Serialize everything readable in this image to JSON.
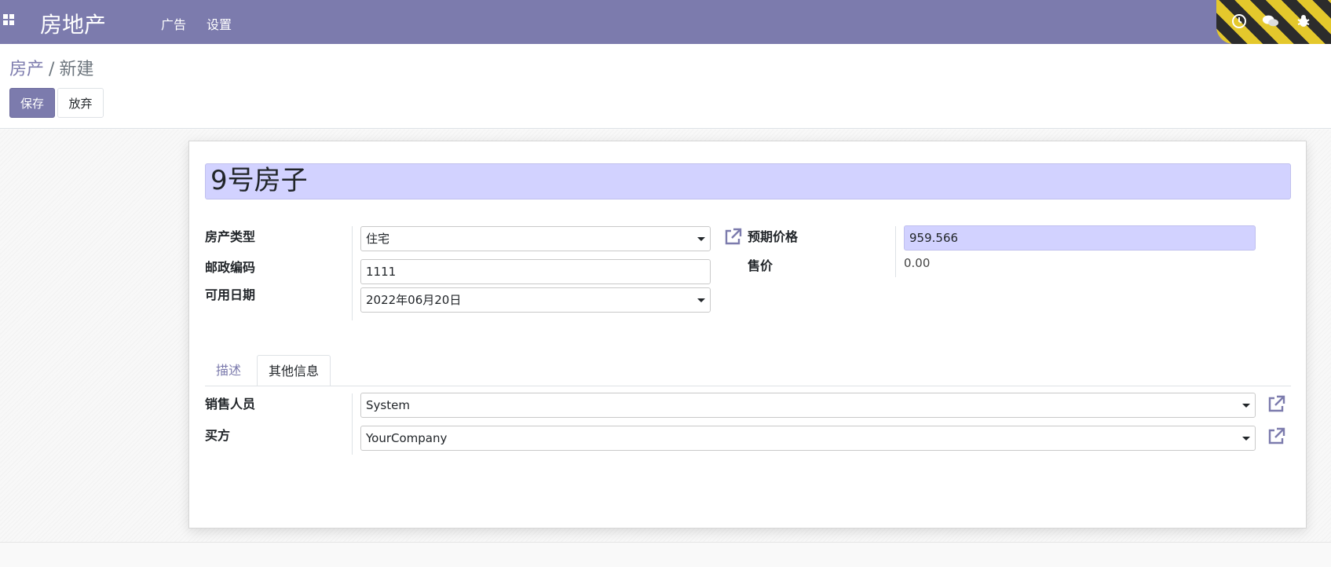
{
  "navbar": {
    "brand": "房地产",
    "menu": [
      "广告",
      "设置"
    ]
  },
  "breadcrumb": {
    "parent": "房产",
    "separator": "/",
    "current": "新建"
  },
  "buttons": {
    "save": "保存",
    "discard": "放弃"
  },
  "form": {
    "name": "9号房子",
    "property_type_label": "房产类型",
    "property_type": "住宅",
    "postcode_label": "邮政编码",
    "postcode": "1111",
    "date_available_label": "可用日期",
    "date_available": "2022年06月20日",
    "expected_price_label": "预期价格",
    "expected_price": "959.566",
    "selling_price_label": "售价",
    "selling_price": "0.00"
  },
  "tabs": [
    "描述",
    "其他信息"
  ],
  "other_info": {
    "salesperson_label": "销售人员",
    "salesperson": "System",
    "buyer_label": "买方",
    "buyer": "YourCompany"
  },
  "colors": {
    "brand": "#7c7bad",
    "highlight_field": "#d2d2ff"
  }
}
